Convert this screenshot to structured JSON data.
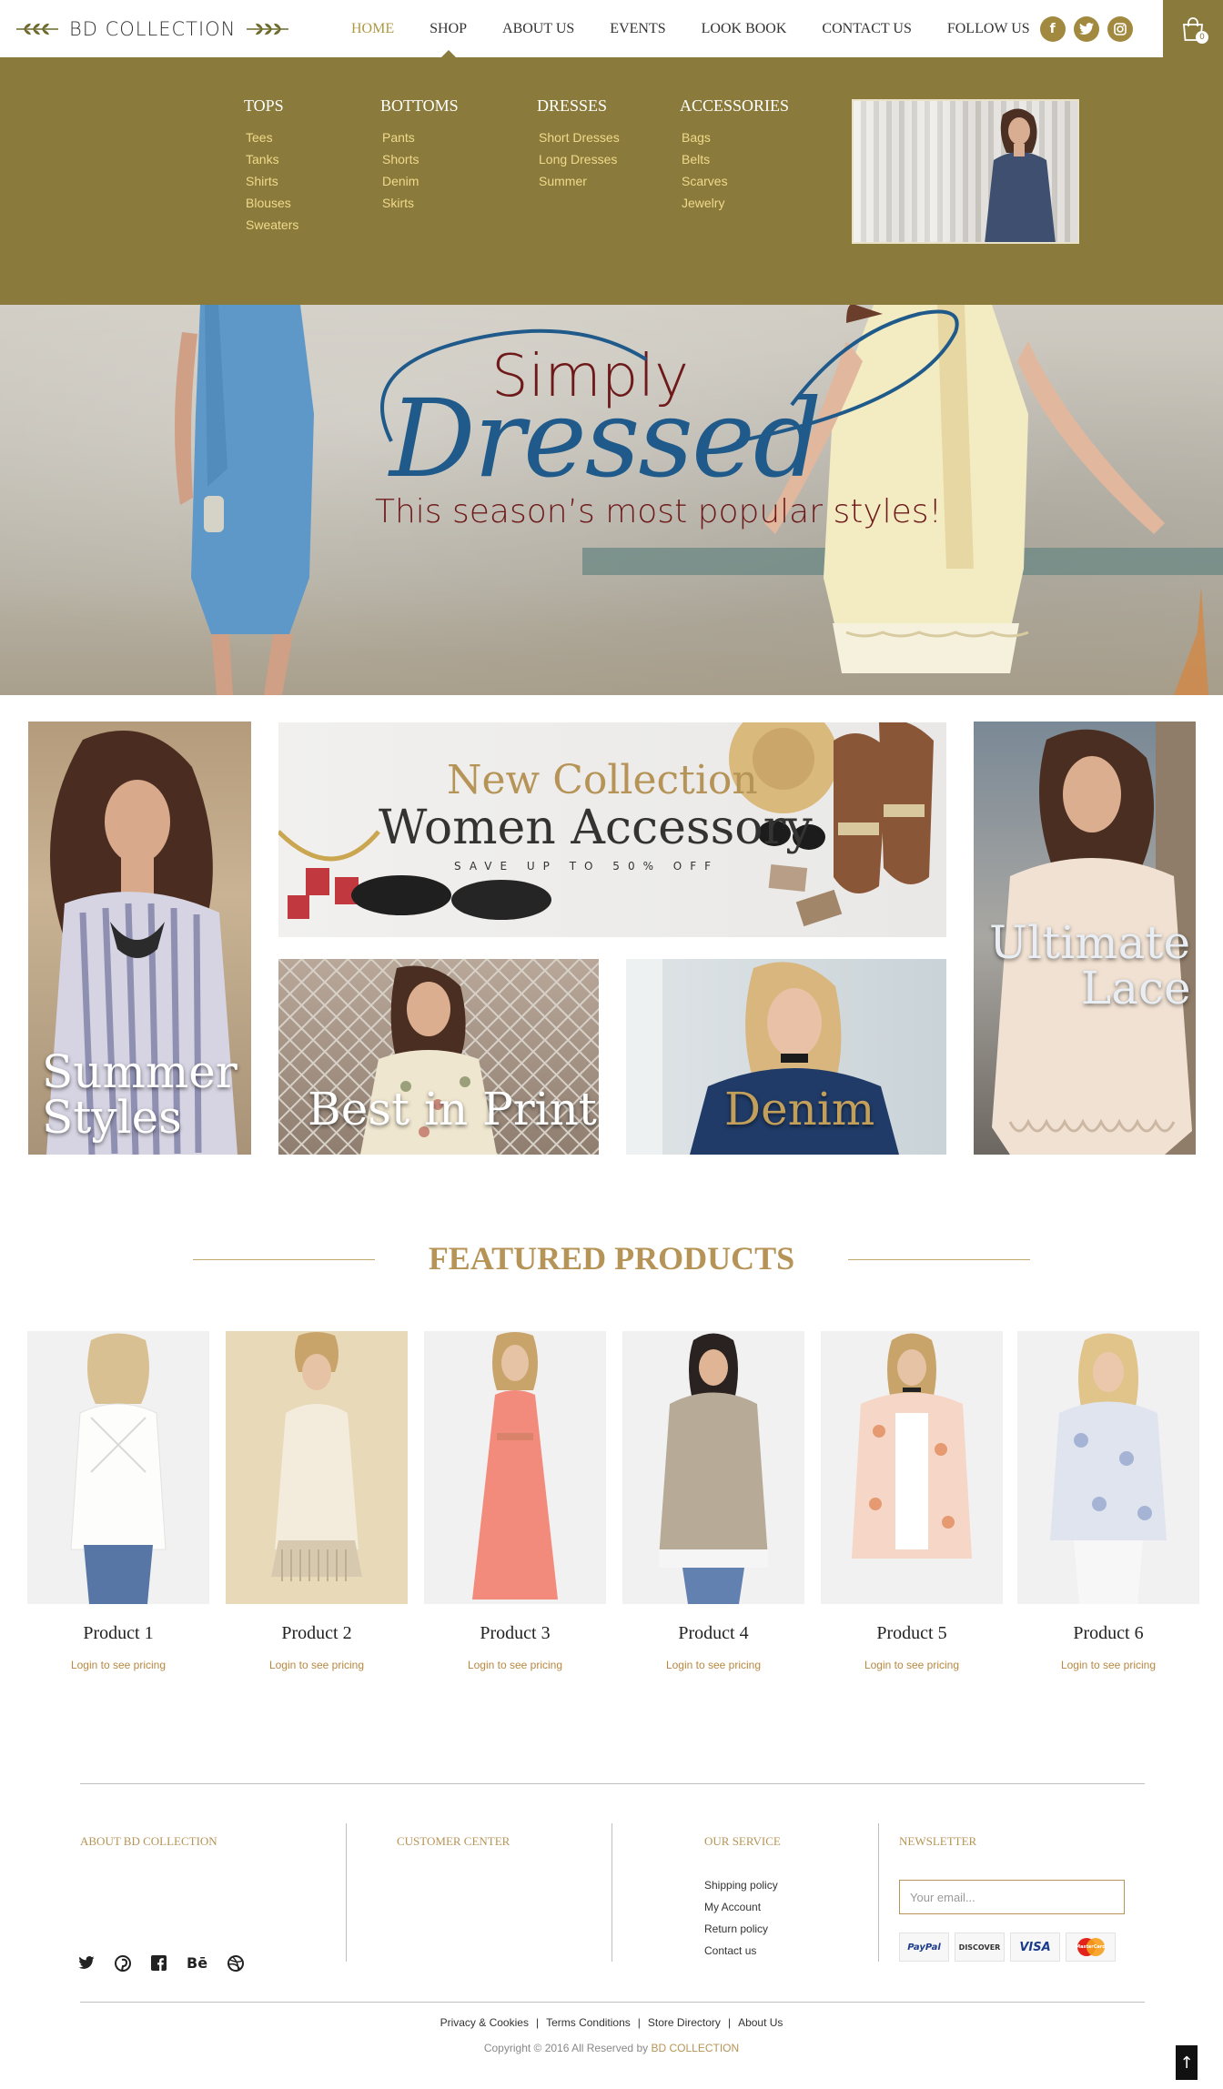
{
  "header": {
    "logo_text": "BD COLLECTION",
    "nav": [
      {
        "label": "HOME",
        "active": true
      },
      {
        "label": "SHOP"
      },
      {
        "label": "ABOUT US"
      },
      {
        "label": "EVENTS"
      },
      {
        "label": "LOOK BOOK"
      },
      {
        "label": "CONTACT US"
      }
    ],
    "follow_label": "FOLLOW US",
    "social": [
      "f",
      "t",
      "i"
    ],
    "cart_count": "0"
  },
  "mega_menu": {
    "columns": [
      {
        "title": "TOPS",
        "links": [
          "Tees",
          "Tanks",
          "Shirts",
          "Blouses",
          "Sweaters"
        ]
      },
      {
        "title": "BOTTOMS",
        "links": [
          "Pants",
          "Shorts",
          "Denim",
          "Skirts"
        ]
      },
      {
        "title": "DRESSES",
        "links": [
          "Short Dresses",
          "Long Dresses",
          "Summer"
        ]
      },
      {
        "title": "ACCESSORIES",
        "links": [
          "Bags",
          "Belts",
          "Scarves",
          "Jewelry"
        ]
      }
    ]
  },
  "hero": {
    "line1": "Simply",
    "line2": "Dressed",
    "tagline": "This season’s most popular styles!"
  },
  "tiles": {
    "summer": "Summer Styles",
    "accessory_top": "New Collection",
    "accessory_main": "Women Accessory",
    "accessory_sub": "SAVE UP TO 50% OFF",
    "print": "Best in Print",
    "denim": "Denim",
    "lace_1": "Ultimate",
    "lace_2": "Lace",
    "summer_1": "Summer",
    "summer_2": "Styles"
  },
  "featured": {
    "title": "FEATURED PRODUCTS",
    "products": [
      {
        "name": "Product 1",
        "price": "Login to see pricing"
      },
      {
        "name": "Product 2",
        "price": "Login to see pricing"
      },
      {
        "name": "Product 3",
        "price": "Login to see pricing"
      },
      {
        "name": "Product 4",
        "price": "Login to see pricing"
      },
      {
        "name": "Product 5",
        "price": "Login to see pricing"
      },
      {
        "name": "Product 6",
        "price": "Login to see pricing"
      }
    ]
  },
  "footer": {
    "about_title": "ABOUT BD COLLECTION",
    "customer_title": "CUSTOMER CENTER",
    "service_title": "OUR SERVICE",
    "service_links": [
      "Shipping policy",
      "My Account",
      "Return policy",
      "Contact us"
    ],
    "newsletter_title": "NEWSLETTER",
    "newsletter_placeholder": "Your email...",
    "payments": [
      "PayPal",
      "DISCOVER",
      "VISA",
      "MasterCard"
    ],
    "bottom_links": [
      "Privacy & Cookies",
      "Terms Conditions",
      "Store Directory",
      "About Us"
    ],
    "copyright": "Copyright © 2016 All Reserved by",
    "copyright_brand": "BD COLLECTION"
  },
  "colors": {
    "accent_olive": "#8a7b3c",
    "accent_gold": "#b69457",
    "menu_link": "#f0d98a",
    "hero_red": "#6e1a1a",
    "hero_blue": "#1f5a8a"
  }
}
